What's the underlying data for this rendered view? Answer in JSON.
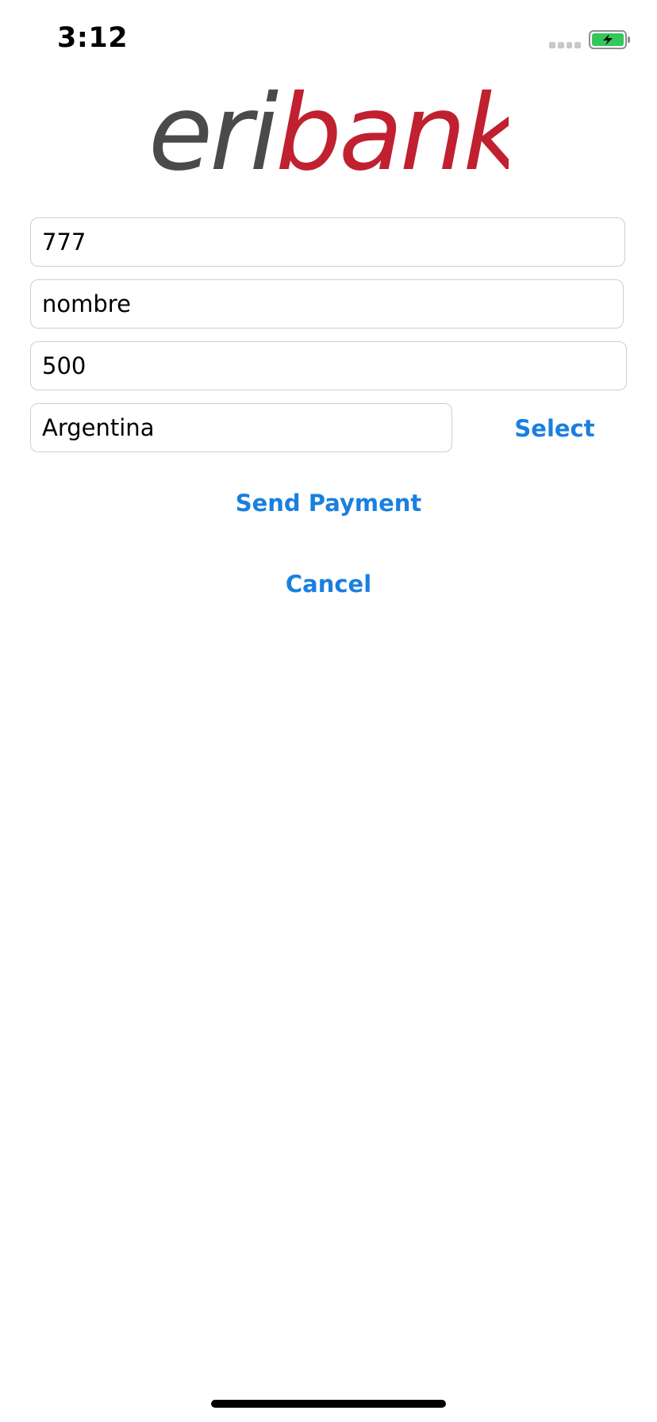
{
  "status_bar": {
    "time": "3:12",
    "battery_color": "#34c759"
  },
  "logo": {
    "part1": "eri",
    "part2": "bank",
    "color1": "#4a4a4a",
    "color2": "#c0202f"
  },
  "form": {
    "account_value": "777",
    "name_value": "nombre",
    "amount_value": "500",
    "country_value": "Argentina"
  },
  "buttons": {
    "select_label": "Select",
    "send_label": "Send Payment",
    "cancel_label": "Cancel",
    "accent_color": "#1a7fe0"
  }
}
